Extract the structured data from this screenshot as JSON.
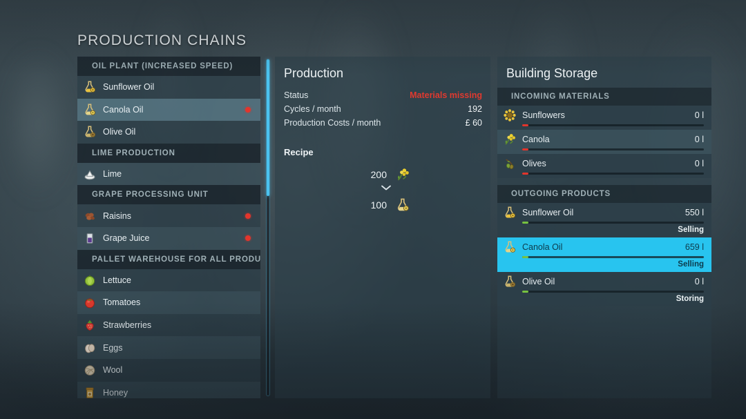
{
  "page": {
    "title": "PRODUCTION CHAINS"
  },
  "colors": {
    "accent_cyan": "#28c4ef",
    "scrollbar_cyan": "#4bc3f0",
    "alert_red": "#e0392f",
    "bar_red": "#e2352c",
    "bar_green": "#77c240"
  },
  "left_list": {
    "groups": [
      {
        "header": "OIL PLANT (INCREASED SPEED)",
        "items": [
          {
            "label": "Sunflower Oil",
            "icon": "flask-sunflower-oil-icon",
            "warning": false,
            "selected": false
          },
          {
            "label": "Canola Oil",
            "icon": "flask-canola-oil-icon",
            "warning": true,
            "selected": true
          },
          {
            "label": "Olive Oil",
            "icon": "flask-olive-oil-icon",
            "warning": false,
            "selected": false
          }
        ]
      },
      {
        "header": "LIME PRODUCTION",
        "items": [
          {
            "label": "Lime",
            "icon": "lime-pile-icon",
            "warning": false,
            "selected": false
          }
        ]
      },
      {
        "header": "GRAPE PROCESSING UNIT",
        "items": [
          {
            "label": "Raisins",
            "icon": "raisins-icon",
            "warning": true,
            "selected": false
          },
          {
            "label": "Grape Juice",
            "icon": "grape-juice-icon",
            "warning": true,
            "selected": false
          }
        ]
      },
      {
        "header": "PALLET WAREHOUSE FOR ALL PRODUC...",
        "items": [
          {
            "label": "Lettuce",
            "icon": "lettuce-icon",
            "warning": false,
            "selected": false
          },
          {
            "label": "Tomatoes",
            "icon": "tomato-icon",
            "warning": false,
            "selected": false
          },
          {
            "label": "Strawberries",
            "icon": "strawberry-icon",
            "warning": false,
            "selected": false
          },
          {
            "label": "Eggs",
            "icon": "eggs-icon",
            "warning": false,
            "selected": false
          },
          {
            "label": "Wool",
            "icon": "wool-icon",
            "warning": false,
            "selected": false
          },
          {
            "label": "Honey",
            "icon": "honey-jar-icon",
            "warning": false,
            "selected": false
          }
        ]
      }
    ]
  },
  "production": {
    "title": "Production",
    "stats": [
      {
        "label": "Status",
        "value": "Materials missing",
        "alert": true
      },
      {
        "label": "Cycles / month",
        "value": "192",
        "alert": false
      },
      {
        "label": "Production Costs / month",
        "value": "£ 60",
        "alert": false
      }
    ],
    "recipe_label": "Recipe",
    "recipe": {
      "input": {
        "qty": "200",
        "icon": "canola-flower-icon"
      },
      "output": {
        "qty": "100",
        "icon": "flask-canola-oil-icon"
      }
    }
  },
  "storage": {
    "title": "Building Storage",
    "groups": [
      {
        "header": "INCOMING MATERIALS",
        "rows": [
          {
            "label": "Sunflowers",
            "amount": "0 l",
            "icon": "sunflower-icon",
            "bar": "red",
            "state": "",
            "selected": false
          },
          {
            "label": "Canola",
            "amount": "0 l",
            "icon": "canola-flower-icon",
            "bar": "red",
            "state": "",
            "selected": false
          },
          {
            "label": "Olives",
            "amount": "0 l",
            "icon": "olives-icon",
            "bar": "red",
            "state": "",
            "selected": false
          }
        ]
      },
      {
        "header": "OUTGOING PRODUCTS",
        "rows": [
          {
            "label": "Sunflower Oil",
            "amount": "550 l",
            "icon": "flask-sunflower-oil-icon",
            "bar": "green",
            "state": "Selling",
            "selected": false
          },
          {
            "label": "Canola Oil",
            "amount": "659 l",
            "icon": "flask-canola-oil-icon",
            "bar": "green",
            "state": "Selling",
            "selected": true
          },
          {
            "label": "Olive Oil",
            "amount": "0 l",
            "icon": "flask-olive-oil-icon",
            "bar": "green",
            "state": "Storing",
            "selected": false
          }
        ]
      }
    ]
  }
}
